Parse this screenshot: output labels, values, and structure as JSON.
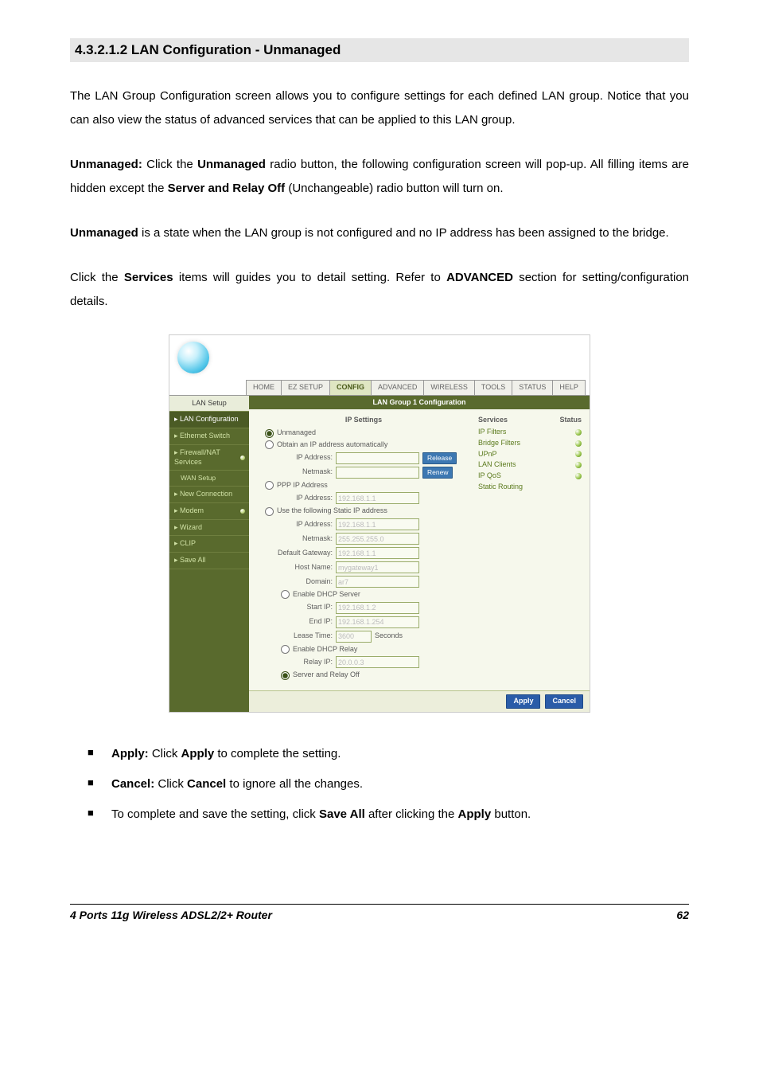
{
  "section_heading": "4.3.2.1.2 LAN Configuration - Unmanaged",
  "paragraphs": {
    "p1": "The LAN Group Configuration screen allows you to configure settings for each defined LAN group. Notice that you can also view the status of advanced services that can be applied to this LAN group.",
    "p2a": "Unmanaged:",
    "p2b": " Click the ",
    "p2c": "Unmanaged",
    "p2d": " radio button, the following configuration screen will pop-up. All filling items are hidden except the ",
    "p2e": "Server and Relay Off",
    "p2f": " (Unchangeable) radio button will turn on.",
    "p3a": "Unmanaged",
    "p3b": " is a state when the LAN group is not configured and no IP address has been assigned to the bridge.",
    "p4a": "Click the ",
    "p4b": "Services",
    "p4c": " items will guides you to detail setting. Refer to ",
    "p4d": "ADVANCED",
    "p4e": " section for setting/configuration details."
  },
  "tabs": [
    "HOME",
    "EZ SETUP",
    "CONFIG",
    "ADVANCED",
    "WIRELESS",
    "TOOLS",
    "STATUS",
    "HELP"
  ],
  "active_tab": 2,
  "sidebar": {
    "heading": "LAN Setup",
    "items": [
      {
        "label": "LAN Configuration",
        "sel": true,
        "arrow": true
      },
      {
        "label": "Ethernet Switch",
        "arrow": true
      },
      {
        "label": "Firewall/NAT Services",
        "arrow": true,
        "dot": true
      },
      {
        "label": "WAN Setup",
        "sub": true
      },
      {
        "label": "New Connection",
        "arrow": true
      },
      {
        "label": "Modem",
        "arrow": true,
        "dot": true
      },
      {
        "label": "Wizard",
        "arrow": true
      },
      {
        "label": "CLIP",
        "arrow": true
      },
      {
        "label": "Save All",
        "arrow": true
      }
    ]
  },
  "panel": {
    "title": "LAN Group 1 Configuration",
    "ip_settings_label": "IP Settings",
    "radios": {
      "unmanaged": "Unmanaged",
      "obtain": "Obtain an IP address automatically",
      "ppp": "PPP IP Address",
      "static": "Use the following Static IP address",
      "dhcp_server": " Enable DHCP Server",
      "dhcp_relay": " Enable DHCP Relay",
      "server_relay_off": " Server and Relay Off"
    },
    "fields": {
      "ip_address_label": "IP Address:",
      "netmask_label": "Netmask:",
      "ppp_ip_label": "IP Address:",
      "ppp_ip_value": "192.168.1.1",
      "static_ip_label": "IP Address:",
      "static_ip_value": "192.168.1.1",
      "static_nm_label": "Netmask:",
      "static_nm_value": "255.255.255.0",
      "gw_label": "Default Gateway:",
      "gw_value": "192.168.1.1",
      "host_label": "Host Name:",
      "host_value": "mygateway1",
      "domain_label": "Domain:",
      "domain_value": "ar7",
      "start_ip_label": "Start IP:",
      "start_ip_value": "192.168.1.2",
      "end_ip_label": "End IP:",
      "end_ip_value": "192.168.1.254",
      "lease_label": "Lease Time:",
      "lease_value": "3600",
      "lease_unit": "Seconds",
      "relay_ip_label": "Relay IP:",
      "relay_ip_value": "20.0.0.3"
    },
    "buttons": {
      "release": "Release",
      "renew": "Renew"
    },
    "services": {
      "head_left": "Services",
      "head_right": "Status",
      "rows": [
        {
          "name": "IP Filters"
        },
        {
          "name": "Bridge Filters"
        },
        {
          "name": "UPnP"
        },
        {
          "name": "LAN Clients"
        },
        {
          "name": "IP QoS"
        },
        {
          "name": "Static Routing",
          "noled": true
        }
      ]
    },
    "footer": {
      "apply": "Apply",
      "cancel": "Cancel"
    }
  },
  "bullets": {
    "b1a": "Apply:",
    "b1b": " Click ",
    "b1c": "Apply",
    "b1d": " to complete the setting.",
    "b2a": "Cancel:",
    "b2b": " Click ",
    "b2c": "Cancel",
    "b2d": " to ignore all the changes.",
    "b3a": "To complete and save the setting, click ",
    "b3b": "Save All",
    "b3c": " after clicking the ",
    "b3d": "Apply",
    "b3e": " button."
  },
  "footer": {
    "title": "4 Ports 11g Wireless ADSL2/2+ Router",
    "page": "62"
  }
}
